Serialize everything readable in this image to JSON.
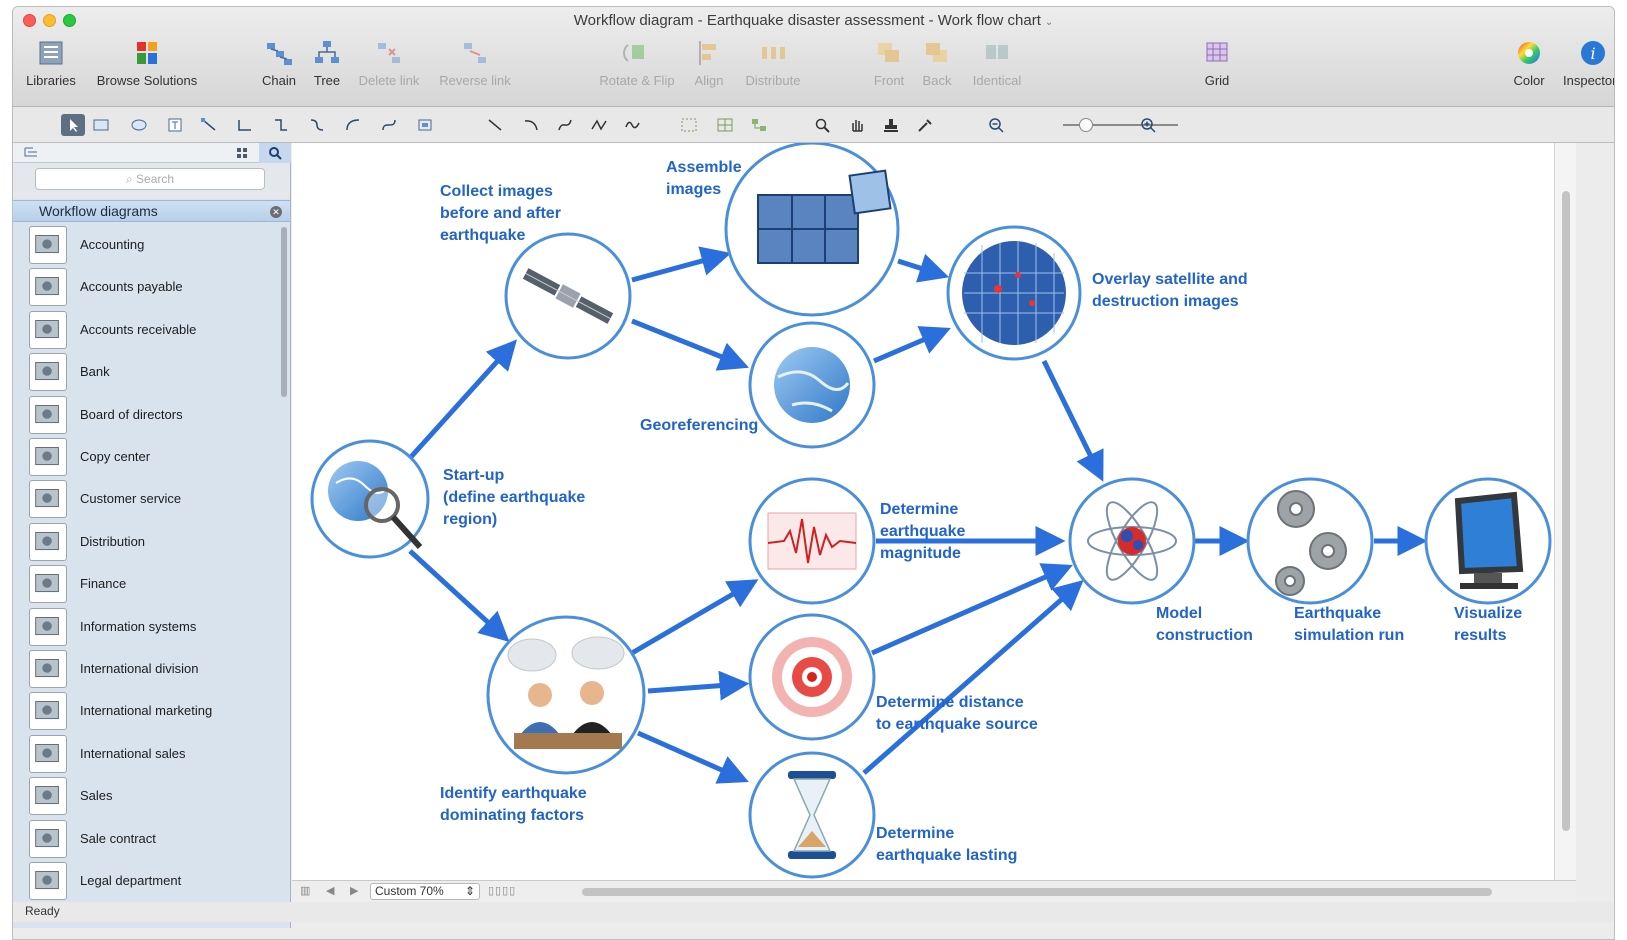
{
  "window": {
    "title": "Workflow diagram - Earthquake disaster assessment - Work flow chart"
  },
  "toolbar": {
    "libraries": "Libraries",
    "browse_solutions": "Browse Solutions",
    "chain": "Chain",
    "tree": "Tree",
    "delete_link": "Delete link",
    "reverse_link": "Reverse link",
    "rotate_flip": "Rotate & Flip",
    "align": "Align",
    "distribute": "Distribute",
    "front": "Front",
    "back": "Back",
    "identical": "Identical",
    "grid": "Grid",
    "color": "Color",
    "inspectors": "Inspectors"
  },
  "zoom_slider": {
    "level": 0.2
  },
  "sidebar": {
    "search_placeholder": "Search",
    "section_title": "Workflow diagrams",
    "items": [
      {
        "label": "Accounting"
      },
      {
        "label": "Accounts payable"
      },
      {
        "label": "Accounts receivable"
      },
      {
        "label": "Bank"
      },
      {
        "label": "Board of directors"
      },
      {
        "label": "Copy center"
      },
      {
        "label": "Customer service"
      },
      {
        "label": "Distribution"
      },
      {
        "label": "Finance"
      },
      {
        "label": "Information systems"
      },
      {
        "label": "International division"
      },
      {
        "label": "International marketing"
      },
      {
        "label": "International sales"
      },
      {
        "label": "Sales"
      },
      {
        "label": "Sale contract"
      },
      {
        "label": "Legal department"
      }
    ]
  },
  "diagram": {
    "accent_color": "#2a6fdb",
    "nodes": {
      "startup": "Start-up\n(define earthquake\nregion)",
      "collect": "Collect images\nbefore and after\nearthquake",
      "assemble": "Assemble\nimages",
      "georef": "Georeferencing",
      "overlay": "Overlay satellite and\ndestruction images",
      "magnitude": "Determine\nearthquake\nmagnitude",
      "distance": "Determine distance\nto earthquake source",
      "lasting": "Determine\nearthquake lasting",
      "identify": "Identify earthquake\ndominating factors",
      "model": "Model\nconstruction",
      "simulation": "Earthquake\nsimulation run",
      "visualize": "Visualize\nresults"
    }
  },
  "bottom_bar": {
    "zoom": "Custom 70%"
  },
  "status": {
    "text": "Ready"
  }
}
